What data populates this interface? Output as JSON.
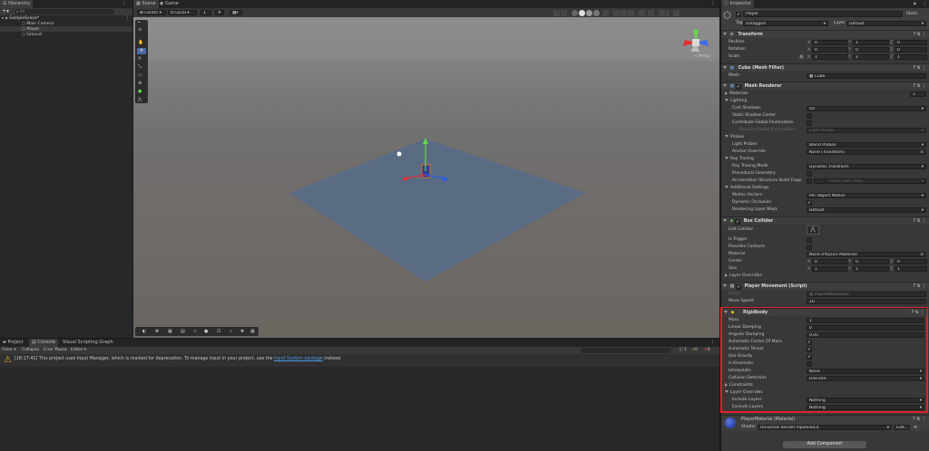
{
  "hierarchy": {
    "tab": "Hierarchy",
    "search_placeholder": "All",
    "scene": "SampleScene*",
    "items": [
      "Main Camera",
      "Player",
      "Ground"
    ]
  },
  "scene_tabs": {
    "scene": "Scene",
    "game": "Game"
  },
  "scene_toolbar": {
    "pivot": "Center",
    "space": "Local",
    "grid_num": "1"
  },
  "viewport": {
    "persp": "< Persp",
    "bg_color": "#6b6560",
    "plane_color": "#5a6b84",
    "sky_color": "#8c8c8c"
  },
  "bottom": {
    "tabs": [
      "Project",
      "Console",
      "Visual Scripting Graph"
    ],
    "toolbar": [
      "Clear",
      "Collapse",
      "Error Pause",
      "Editor"
    ],
    "counts": [
      "1",
      "0",
      "0"
    ],
    "message_pre": "[18:17:41] This project uses Input Manager, which is marked for deprecation. To manage input in your project, use the",
    "message_link": "Input System package",
    "message_post": "instead."
  },
  "inspector": {
    "tab": "Inspector",
    "object_name": "Player",
    "static": "Static",
    "tag_label": "Tag",
    "tag": "Untagged",
    "layer_label": "Layer",
    "layer": "Default",
    "transform": {
      "title": "Transform",
      "rows": [
        {
          "label": "Position",
          "x": "0",
          "y": "1",
          "z": "0"
        },
        {
          "label": "Rotation",
          "x": "0",
          "y": "0",
          "z": "0"
        },
        {
          "label": "Scale",
          "x": "1",
          "y": "2",
          "z": "1"
        }
      ]
    },
    "mesh_filter": {
      "title": "Cube (Mesh Filter)",
      "mesh_label": "Mesh",
      "mesh": "Cube"
    },
    "mesh_renderer": {
      "title": "Mesh Renderer",
      "materials": "Materials",
      "materials_count": "1",
      "lighting": "Lighting",
      "cast_shadows": "Cast Shadows",
      "cast_shadows_val": "On",
      "static_shadow": "Static Shadow Caster",
      "contribute_gi": "Contribute Global Illumination",
      "receive_gi": "Receive Global Illumination",
      "receive_gi_val": "Light Probes",
      "probes": "Probes",
      "light_probes": "Light Probes",
      "light_probes_val": "Blend Probes",
      "anchor_override": "Anchor Override",
      "anchor_override_val": "None (Transform)",
      "ray_tracing": "Ray Tracing",
      "ray_tracing_mode": "Ray Tracing Mode",
      "ray_tracing_mode_val": "Dynamic Transform",
      "procedural_geometry": "Procedural Geometry",
      "accel_flags": "Acceleration Structure Build Flags",
      "accel_flags_val": "Prefer Fast Trace",
      "additional": "Additional Settings",
      "motion_vectors": "Motion Vectors",
      "motion_vectors_val": "Per Object Motion",
      "dynamic_occlusion": "Dynamic Occlusion",
      "rendering_layer_mask": "Rendering Layer Mask",
      "rendering_layer_mask_val": "Default"
    },
    "box_collider": {
      "title": "Box Collider",
      "edit_collider": "Edit Collider",
      "is_trigger": "Is Trigger",
      "provides_contacts": "Provides Contacts",
      "material": "Material",
      "material_val": "None (Physics Material)",
      "center": "Center",
      "center_vals": [
        "0",
        "0",
        "0"
      ],
      "size": "Size",
      "size_vals": [
        "1",
        "1",
        "1"
      ],
      "layer_overrides": "Layer Overrides"
    },
    "player_movement": {
      "title": "Player Movement (Script)",
      "script": "Script",
      "script_val": "PlayerMovement",
      "move_speed": "Move Speed",
      "move_speed_val": "10"
    },
    "rigidbody": {
      "title": "Rigidbody",
      "mass": "Mass",
      "mass_val": "1",
      "linear_damping": "Linear Damping",
      "linear_damping_val": "0",
      "angular_damping": "Angular Damping",
      "angular_damping_val": "0.05",
      "auto_com": "Automatic Center Of Mass",
      "auto_tensor": "Automatic Tensor",
      "use_gravity": "Use Gravity",
      "is_kinematic": "Is Kinematic",
      "interpolate": "Interpolate",
      "interpolate_val": "None",
      "collision_detection": "Collision Detection",
      "collision_detection_val": "Discrete",
      "constraints": "Constraints",
      "layer_overrides": "Layer Overrides",
      "include_layers": "Include Layers",
      "include_layers_val": "Nothing",
      "exclude_layers": "Exclude Layers",
      "exclude_layers_val": "Nothing"
    },
    "material": {
      "title": "PlayerMaterial (Material)",
      "shader_label": "Shader",
      "shader": "Universal Render Pipeline/Lit",
      "edit": "Edit..."
    },
    "add_component": "Add Component",
    "highlight_color": "#e0202a"
  }
}
